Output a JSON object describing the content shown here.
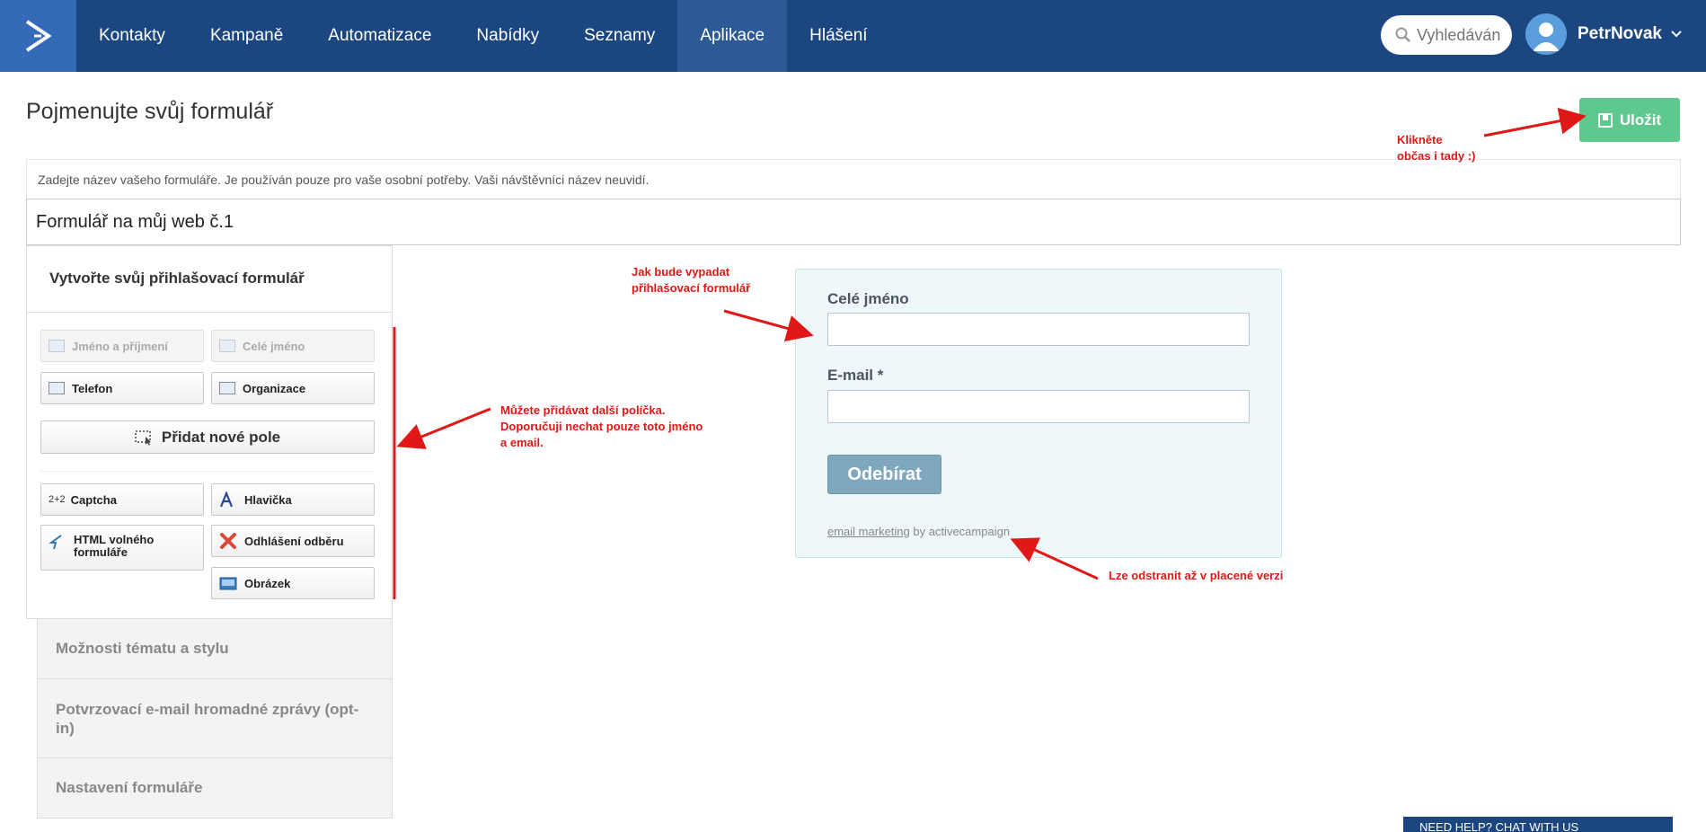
{
  "nav": {
    "items": [
      {
        "label": "Kontakty"
      },
      {
        "label": "Kampaně"
      },
      {
        "label": "Automatizace"
      },
      {
        "label": "Nabídky"
      },
      {
        "label": "Seznamy"
      },
      {
        "label": "Aplikace"
      },
      {
        "label": "Hlášení"
      }
    ],
    "active_index": 5,
    "search_placeholder": "Vyhledáván",
    "user_name": "PetrNovak"
  },
  "page": {
    "title": "Pojmenujte svůj formulář",
    "save_label": "Uložit",
    "hint": "Zadejte název vašeho formuláře. Je používán pouze pro vaše osobní potřeby. Vaši návštěvníci název neuvidí.",
    "form_name_value": "Formulář na můj web č.1"
  },
  "builder": {
    "title": "Vytvořte svůj přihlašovací formulář",
    "fields": [
      {
        "label": "Jméno a příjmení",
        "disabled": true
      },
      {
        "label": "Celé jméno",
        "disabled": true
      },
      {
        "label": "Telefon"
      },
      {
        "label": "Organizace"
      }
    ],
    "add_field_label": "Přidat nové pole",
    "elements": [
      {
        "label": "Captcha",
        "icon": "captcha-icon",
        "icon_text": "2+2"
      },
      {
        "label": "Hlavička",
        "icon": "header-icon"
      },
      {
        "label": "HTML volného formuláře",
        "icon": "html-icon"
      },
      {
        "label": "Odhlášení odběru",
        "icon": "unsubscribe-icon"
      },
      {
        "label": "Obrázek",
        "icon": "image-icon"
      }
    ]
  },
  "accordion": [
    {
      "label": "Možnosti tématu a stylu"
    },
    {
      "label": "Potvrzovací e-mail hromadné zprávy (opt-in)"
    },
    {
      "label": "Nastavení formuláře"
    }
  ],
  "preview": {
    "name_label": "Celé jméno",
    "email_label": "E-mail *",
    "submit_label": "Odebírat",
    "footer_link": "email marketing",
    "footer_text": " by activecampaign"
  },
  "annotations": {
    "save_note_1": "Klikněte",
    "save_note_2": "občas i tady :)",
    "preview_note_1": "Jak bude vypadat",
    "preview_note_2": "přihlašovací formulář",
    "fields_note_1": "Můžete přidávat další políčka.",
    "fields_note_2": "Doporučuji nechat pouze toto jméno",
    "fields_note_3": "a email.",
    "footer_note": "Lze odstranit až v placené verzi"
  },
  "chat": {
    "label": "NEED HELP? CHAT WITH US"
  },
  "colors": {
    "nav_bg": "#1c4680",
    "logo_bg": "#356ab8",
    "save_green": "#5ec98e",
    "annotation_red": "#e01818",
    "preview_bg": "#eef8fb"
  }
}
